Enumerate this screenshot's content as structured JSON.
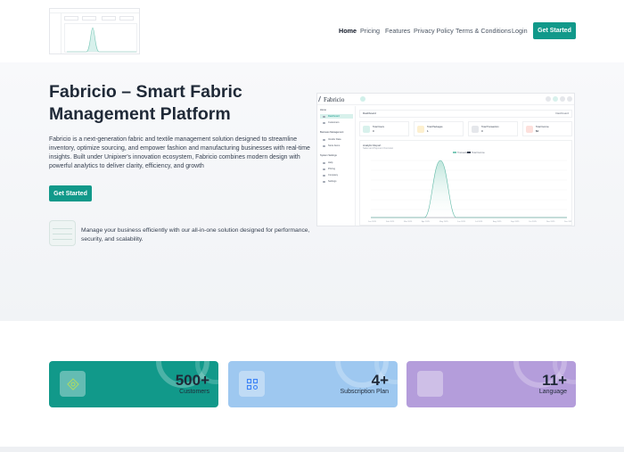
{
  "nav": {
    "links": [
      "Home",
      "Pricing",
      "Features",
      "Privacy Policy",
      "Terms & Conditions",
      "Login"
    ],
    "cta": "Get Started"
  },
  "hero": {
    "title": "Fabricio – Smart Fabric Management Platform",
    "description": "Fabricio is a next-generation fabric and textile management solution designed to streamline inventory, optimize sourcing, and empower fashion and manufacturing businesses with real-time insights. Built under Unipixer's innovation ecosystem, Fabricio combines modern design with powerful analytics to deliver clarity, efficiency, and growth",
    "cta": "Get Started",
    "feature_text": "Manage your business efficiently with our all-in-one solution designed for performance, security, and scalability."
  },
  "dashboard": {
    "brand": "Fabricio",
    "header": "Dashboard",
    "header_right": "Dashboard",
    "sidebar": {
      "section1": "Home",
      "items1": [
        "Dashboard",
        "Customers"
      ],
      "section2": "Business Management",
      "items2": [
        "Vendor Data",
        "Store Items"
      ],
      "section3": "System Settings",
      "items3": [
        "Help",
        "Pricing",
        "Company",
        "Settings"
      ]
    },
    "cards": [
      {
        "label": "Total Users",
        "value": "0",
        "color": "#d8f1ec"
      },
      {
        "label": "Total Packages",
        "value": "1",
        "color": "#fdf0cf"
      },
      {
        "label": "Total Transaction",
        "value": "0",
        "color": "#e5e7eb"
      },
      {
        "label": "Total Income",
        "value": "$0",
        "color": "#fde0dc"
      }
    ],
    "chart": {
      "title": "Analytic Report",
      "subtitle": "Sales and Payment Overview",
      "legend": [
        "Transaction",
        "Total Income"
      ],
      "x_labels": [
        "Jan 2025",
        "Feb 2025",
        "Mar 2025",
        "Apr 2025",
        "May 2025",
        "Jun 2025",
        "Jul 2025",
        "Aug 2025",
        "Sep 2025",
        "Oct 2025",
        "Nov 2025",
        "Dec 2025"
      ]
    }
  },
  "stats": [
    {
      "value": "500+",
      "label": "Customers",
      "color": "#11998a",
      "icon": "customers-icon"
    },
    {
      "value": "4+",
      "label": "Subscription Plan",
      "color": "#9ec8f0",
      "icon": "subscription-icon"
    },
    {
      "value": "11+",
      "label": "Language",
      "color": "#b49ddb",
      "icon": "language-icon"
    }
  ],
  "colors": {
    "accent": "#11998a",
    "hero_bg": "#f3f5f8"
  }
}
